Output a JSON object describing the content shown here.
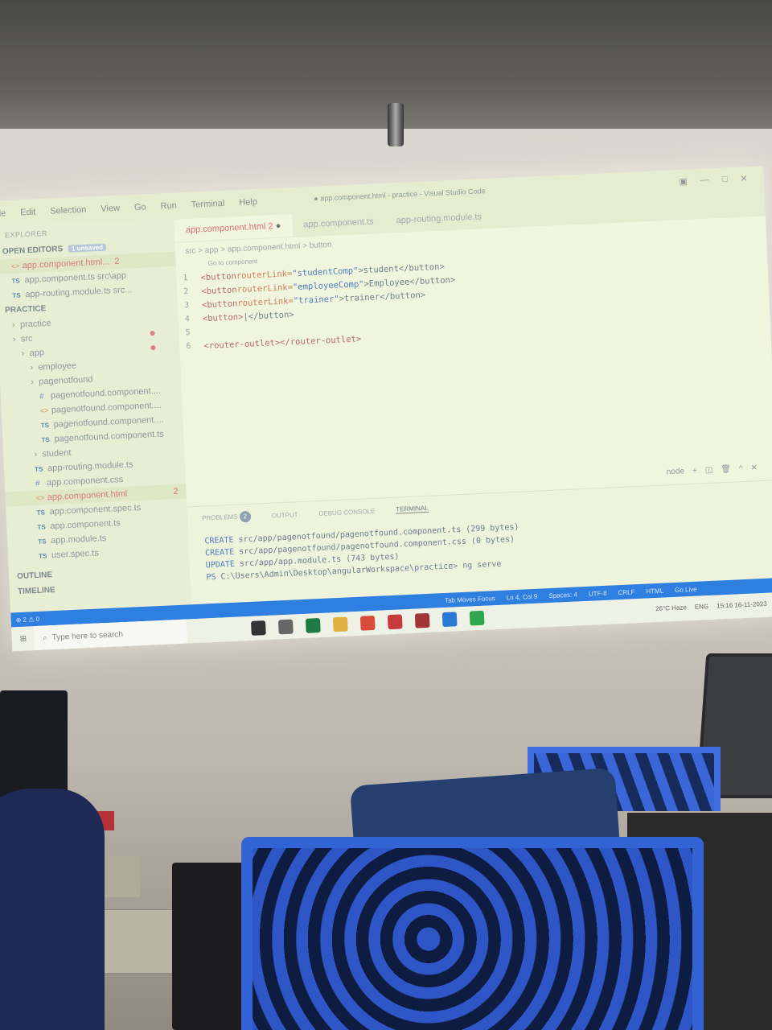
{
  "menu": [
    "le",
    "Edit",
    "Selection",
    "View",
    "Go",
    "Run",
    "Terminal",
    "Help"
  ],
  "window_title": "● app.component.html - practice - Visual Studio Code",
  "explorer": {
    "header": "EXPLORER",
    "open_editors_label": "OPEN EDITORS",
    "unsaved_badge": "1 unsaved",
    "open_files": [
      {
        "name": "app.component.html...",
        "count": "2",
        "type": "html"
      },
      {
        "name": "app.component.ts src\\app",
        "type": "ts"
      },
      {
        "name": "app-routing.module.ts src...",
        "type": "ts"
      }
    ],
    "project_label": "PRACTICE",
    "tree": [
      {
        "name": "practice",
        "indent": 1,
        "kind": "folder"
      },
      {
        "name": "src",
        "indent": 1,
        "kind": "folder",
        "modified": true
      },
      {
        "name": "app",
        "indent": 2,
        "kind": "folder",
        "modified": true
      },
      {
        "name": "employee",
        "indent": 3,
        "kind": "folder"
      },
      {
        "name": "pagenotfound",
        "indent": 3,
        "kind": "folder"
      },
      {
        "name": "pagenotfound.component....",
        "indent": 4,
        "kind": "css"
      },
      {
        "name": "pagenotfound.component....",
        "indent": 4,
        "kind": "html"
      },
      {
        "name": "pagenotfound.component....",
        "indent": 4,
        "kind": "ts"
      },
      {
        "name": "pagenotfound.component.ts",
        "indent": 4,
        "kind": "ts"
      },
      {
        "name": "student",
        "indent": 3,
        "kind": "folder"
      },
      {
        "name": "app-routing.module.ts",
        "indent": 3,
        "kind": "ts"
      },
      {
        "name": "app.component.css",
        "indent": 3,
        "kind": "css"
      },
      {
        "name": "app.component.html",
        "indent": 3,
        "kind": "html",
        "active": true,
        "count": "2"
      },
      {
        "name": "app.component.spec.ts",
        "indent": 3,
        "kind": "ts"
      },
      {
        "name": "app.component.ts",
        "indent": 3,
        "kind": "ts"
      },
      {
        "name": "app.module.ts",
        "indent": 3,
        "kind": "ts"
      },
      {
        "name": "user.spec.ts",
        "indent": 3,
        "kind": "ts"
      }
    ],
    "outline_label": "OUTLINE",
    "timeline_label": "TIMELINE"
  },
  "editor": {
    "tabs": [
      {
        "label": "app.component.html 2",
        "active": true
      },
      {
        "label": "app.component.ts",
        "active": false
      },
      {
        "label": "app-routing.module.ts",
        "active": false
      }
    ],
    "breadcrumb": "src > app > app.component.html > button",
    "goto_hint": "Go to component",
    "lines": [
      {
        "n": "1",
        "tag_open": "<button ",
        "attr": "routerLink=",
        "val": "\"studentComp\"",
        "text": ">student</button>"
      },
      {
        "n": "2",
        "tag_open": "<button ",
        "attr": "routerLink=",
        "val": "\"employeeComp\"",
        "text": ">Employee</button>"
      },
      {
        "n": "3",
        "tag_open": "<button ",
        "attr": "routerLink=",
        "val": "\"trainer\"",
        "text": ">trainer</button>"
      },
      {
        "n": "4",
        "tag_open": "<button>",
        "attr": "",
        "val": "",
        "text": "|</button>"
      },
      {
        "n": "5",
        "tag_open": "",
        "attr": "",
        "val": "",
        "text": ""
      },
      {
        "n": "6",
        "tag_open": "<router-outlet></router-outlet>",
        "attr": "",
        "val": "",
        "text": ""
      }
    ]
  },
  "panel": {
    "tabs": [
      "PROBLEMS",
      "OUTPUT",
      "DEBUG CONSOLE",
      "TERMINAL"
    ],
    "problems_count": "2",
    "terminal_shell": "node",
    "terminal_lines": [
      {
        "kw": "CREATE",
        "rest": "src/app/pagenotfound/pagenotfound.component.ts (299 bytes)"
      },
      {
        "kw": "CREATE",
        "rest": "src/app/pagenotfound/pagenotfound.component.css (0 bytes)"
      },
      {
        "kw": "UPDATE",
        "rest": "src/app/app.module.ts (743 bytes)"
      },
      {
        "kw": "PS",
        "rest": "C:\\Users\\Admin\\Desktop\\angularWorkspace\\practice> ng serve"
      }
    ]
  },
  "statusbar": {
    "left": "⊗ 2 ⚠ 0",
    "items": [
      "Tab Moves Focus",
      "Ln 4, Col 9",
      "Spaces: 4",
      "UTF-8",
      "CRLF",
      "HTML",
      "Go Live"
    ]
  },
  "taskbar": {
    "search_placeholder": "Type here to search",
    "weather": "26°C Haze",
    "lang": "ENG",
    "time": "15:16",
    "date": "16-11-2023"
  }
}
